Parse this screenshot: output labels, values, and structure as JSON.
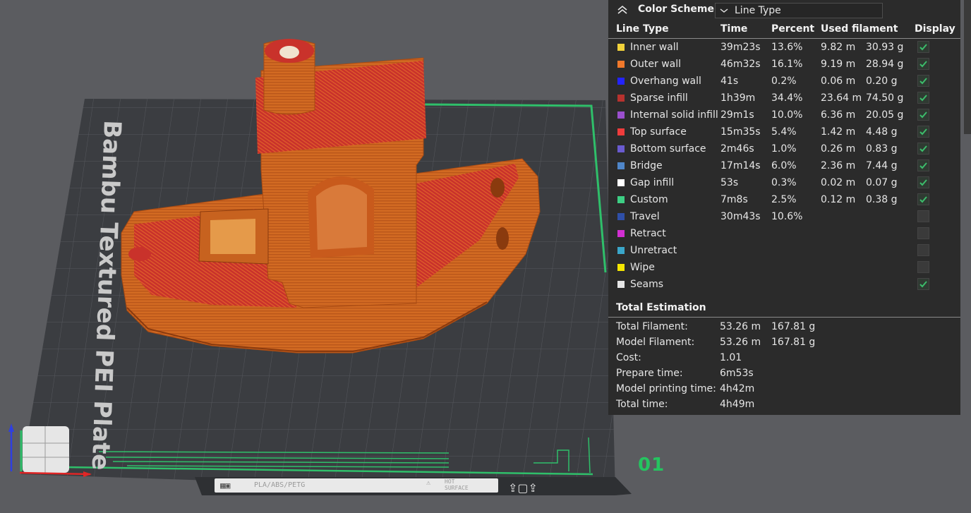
{
  "viewport": {
    "bed_label": "Bambu Textured PEI Plate",
    "plate_number": "01",
    "plate_strip": {
      "materials": "PLA/ABS/PETG",
      "hot_surface_line1": "HOT",
      "hot_surface_line2": "SURFACE"
    },
    "colors": {
      "background": "#5b5c60",
      "bed": "#3b3d41",
      "model_orange": "#d9691f",
      "model_red": "#c8302a",
      "border_green": "#2fbf6a"
    }
  },
  "panel": {
    "color_scheme_label": "Color Scheme",
    "color_scheme_value": "Line Type",
    "columns": {
      "line_type": "Line Type",
      "time": "Time",
      "percent": "Percent",
      "used_filament": "Used filament",
      "display": "Display"
    },
    "rows": [
      {
        "name": "Inner wall",
        "color": "#f2d23a",
        "time": "39m23s",
        "percent": "13.6%",
        "length": "9.82 m",
        "weight": "30.93 g",
        "checked": true
      },
      {
        "name": "Outer wall",
        "color": "#f2792b",
        "time": "46m32s",
        "percent": "16.1%",
        "length": "9.19 m",
        "weight": "28.94 g",
        "checked": true
      },
      {
        "name": "Overhang wall",
        "color": "#2323ff",
        "time": "41s",
        "percent": "0.2%",
        "length": "0.06 m",
        "weight": "0.20 g",
        "checked": true
      },
      {
        "name": "Sparse infill",
        "color": "#b7322e",
        "time": "1h39m",
        "percent": "34.4%",
        "length": "23.64 m",
        "weight": "74.50 g",
        "checked": true
      },
      {
        "name": "Internal solid infill",
        "color": "#9b4fce",
        "time": "29m1s",
        "percent": "10.0%",
        "length": "6.36 m",
        "weight": "20.05 g",
        "checked": true
      },
      {
        "name": "Top surface",
        "color": "#f03c3c",
        "time": "15m35s",
        "percent": "5.4%",
        "length": "1.42 m",
        "weight": "4.48 g",
        "checked": true
      },
      {
        "name": "Bottom surface",
        "color": "#6a5bd0",
        "time": "2m46s",
        "percent": "1.0%",
        "length": "0.26 m",
        "weight": "0.83 g",
        "checked": true
      },
      {
        "name": "Bridge",
        "color": "#4f86c9",
        "time": "17m14s",
        "percent": "6.0%",
        "length": "2.36 m",
        "weight": "7.44 g",
        "checked": true
      },
      {
        "name": "Gap infill",
        "color": "#ffffff",
        "time": "53s",
        "percent": "0.3%",
        "length": "0.02 m",
        "weight": "0.07 g",
        "checked": true
      },
      {
        "name": "Custom",
        "color": "#3dcf84",
        "time": "7m8s",
        "percent": "2.5%",
        "length": "0.12 m",
        "weight": "0.38 g",
        "checked": true
      },
      {
        "name": "Travel",
        "color": "#2f4fa8",
        "time": "30m43s",
        "percent": "10.6%",
        "length": "",
        "weight": "",
        "checked": false
      },
      {
        "name": "Retract",
        "color": "#d22fd2",
        "time": "",
        "percent": "",
        "length": "",
        "weight": "",
        "checked": false
      },
      {
        "name": "Unretract",
        "color": "#3aa6c9",
        "time": "",
        "percent": "",
        "length": "",
        "weight": "",
        "checked": false
      },
      {
        "name": "Wipe",
        "color": "#f5e600",
        "time": "",
        "percent": "",
        "length": "",
        "weight": "",
        "checked": false
      },
      {
        "name": "Seams",
        "color": "#e6e6e6",
        "time": "",
        "percent": "",
        "length": "",
        "weight": "",
        "checked": true
      }
    ],
    "total_estimation": {
      "title": "Total Estimation",
      "lines": [
        {
          "label": "Total Filament:",
          "value1": "53.26 m",
          "value2": "167.81 g"
        },
        {
          "label": "Model Filament:",
          "value1": "53.26 m",
          "value2": "167.81 g"
        },
        {
          "label": "Cost:",
          "value1": "1.01",
          "value2": ""
        },
        {
          "label": "Prepare time:",
          "value1": "6m53s",
          "value2": ""
        },
        {
          "label": "Model printing time:",
          "value1": "4h42m",
          "value2": ""
        },
        {
          "label": "Total time:",
          "value1": "4h49m",
          "value2": ""
        }
      ]
    }
  }
}
